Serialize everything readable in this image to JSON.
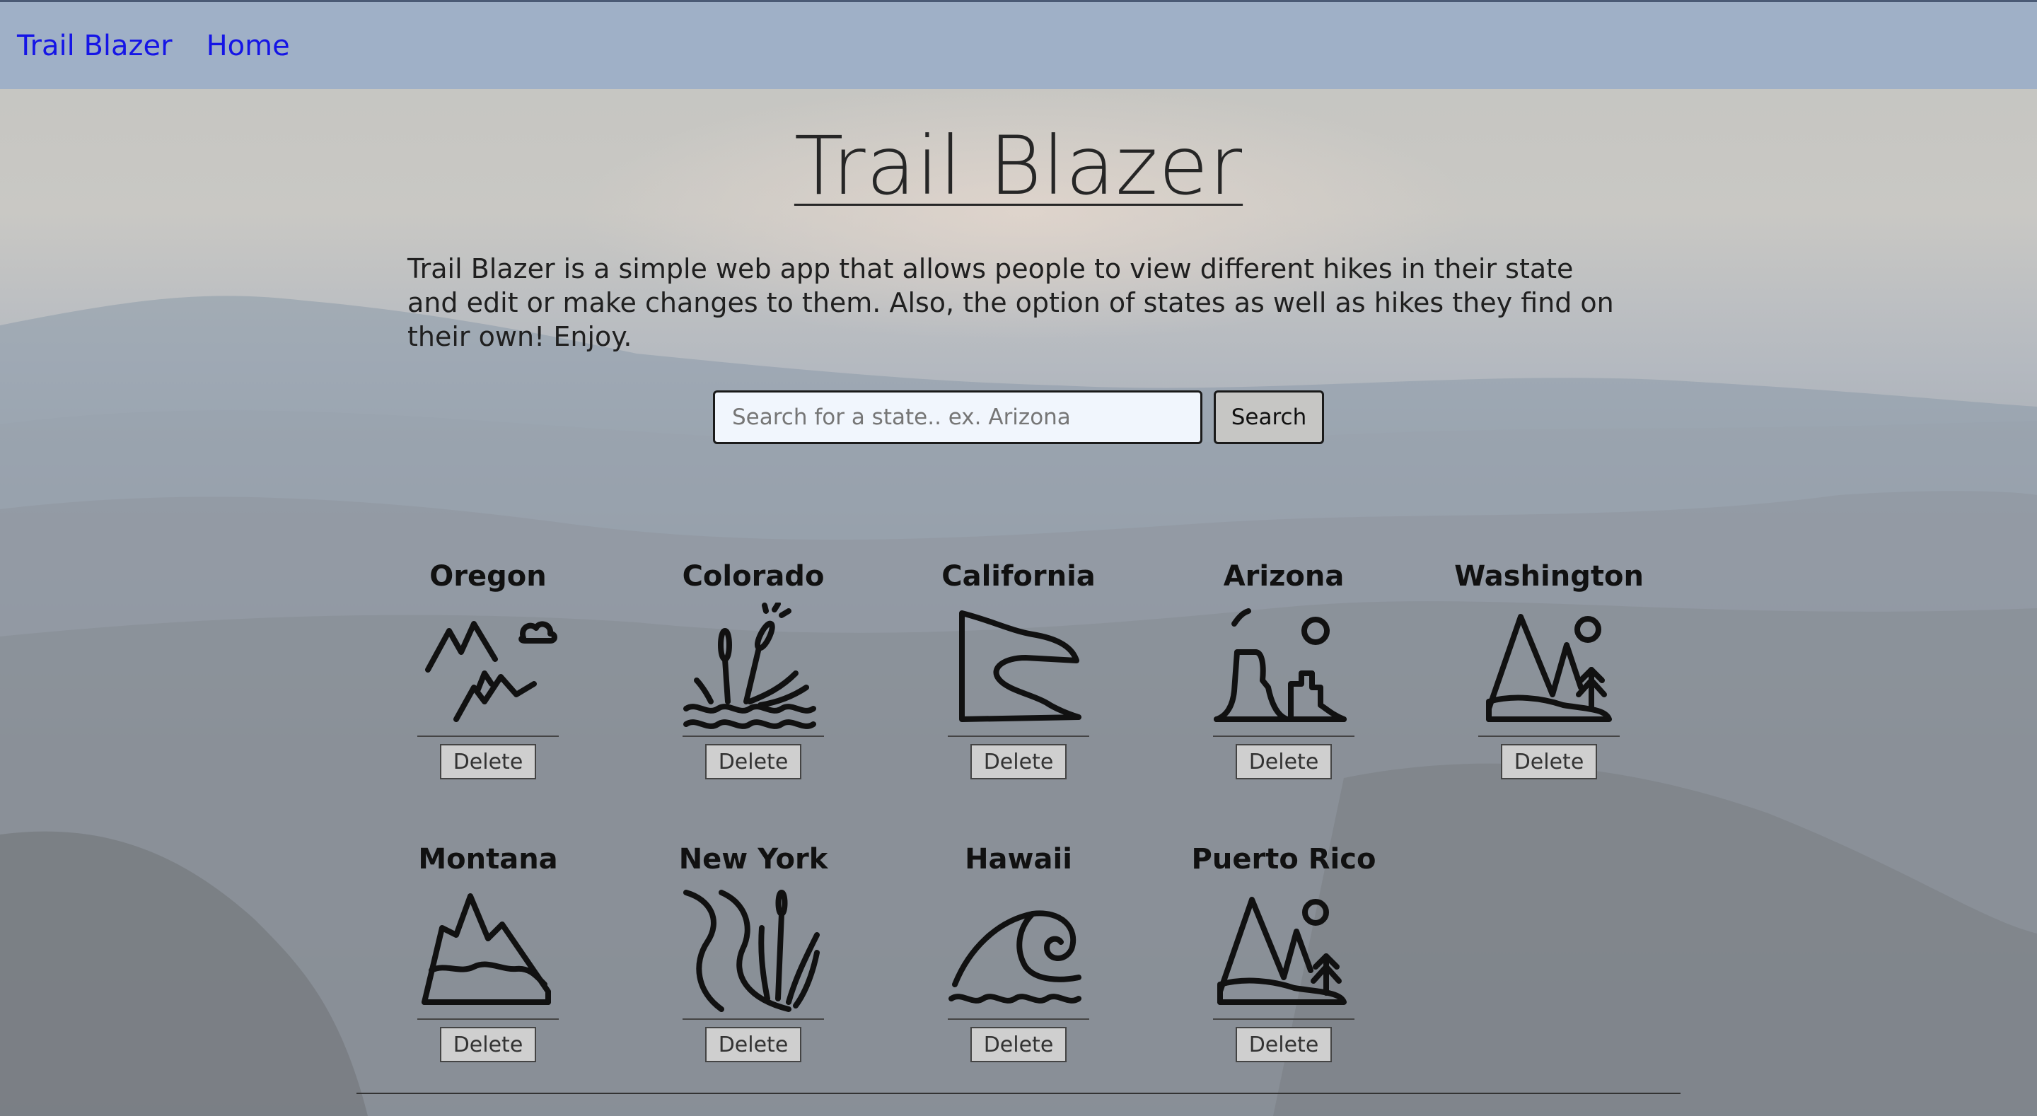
{
  "nav": {
    "brand": "Trail Blazer",
    "home": "Home"
  },
  "page": {
    "title": "Trail Blazer",
    "intro": "Trail Blazer is a simple web app that allows people to view different hikes in their state and edit or make changes to them. Also, the option of states as well as hikes they find on their own! Enjoy."
  },
  "search": {
    "placeholder": "Search for a state.. ex. Arizona",
    "button_label": "Search"
  },
  "states": [
    {
      "name": "Oregon",
      "icon": "mountains-cloud-icon",
      "delete_label": "Delete"
    },
    {
      "name": "Colorado",
      "icon": "cattails-water-icon",
      "delete_label": "Delete"
    },
    {
      "name": "California",
      "icon": "cliff-river-icon",
      "delete_label": "Delete"
    },
    {
      "name": "Arizona",
      "icon": "desert-buttes-icon",
      "delete_label": "Delete"
    },
    {
      "name": "Washington",
      "icon": "mountain-tree-sun-icon",
      "delete_label": "Delete"
    },
    {
      "name": "Montana",
      "icon": "snowy-mountain-icon",
      "delete_label": "Delete"
    },
    {
      "name": "New York",
      "icon": "river-reeds-icon",
      "delete_label": "Delete"
    },
    {
      "name": "Hawaii",
      "icon": "wave-icon",
      "delete_label": "Delete"
    },
    {
      "name": "Puerto Rico",
      "icon": "mountain-tree-sun-icon",
      "delete_label": "Delete"
    }
  ]
}
